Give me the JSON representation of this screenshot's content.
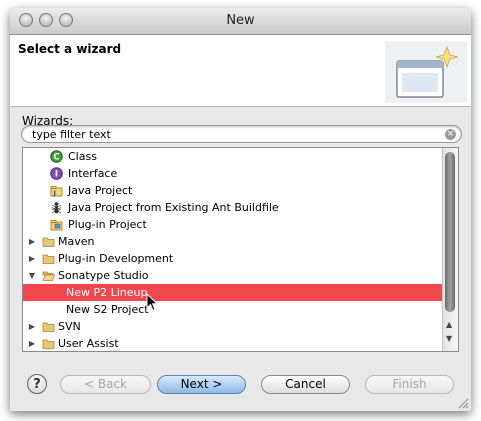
{
  "window": {
    "title": "New"
  },
  "header": {
    "title": "Select a wizard"
  },
  "wizards": {
    "label": "Wizards:",
    "filter_placeholder": "type filter text",
    "items": [
      {
        "label": "Class",
        "icon": "class-icon",
        "depth": 1,
        "disclosure": "none"
      },
      {
        "label": "Interface",
        "icon": "interface-icon",
        "depth": 1,
        "disclosure": "none"
      },
      {
        "label": "Java Project",
        "icon": "java-project-icon",
        "depth": 1,
        "disclosure": "none"
      },
      {
        "label": "Java Project from Existing Ant Buildfile",
        "icon": "ant-icon",
        "depth": 1,
        "disclosure": "none"
      },
      {
        "label": "Plug-in Project",
        "icon": "plugin-project-icon",
        "depth": 1,
        "disclosure": "none"
      },
      {
        "label": "Maven",
        "icon": "folder-icon",
        "depth": 0,
        "disclosure": "collapsed"
      },
      {
        "label": "Plug-in Development",
        "icon": "folder-icon",
        "depth": 0,
        "disclosure": "collapsed"
      },
      {
        "label": "Sonatype Studio",
        "icon": "folder-open-icon",
        "depth": 0,
        "disclosure": "expanded"
      },
      {
        "label": "New P2 Lineup",
        "icon": "",
        "depth": 2,
        "disclosure": "none",
        "selected": true
      },
      {
        "label": "New S2 Project",
        "icon": "",
        "depth": 2,
        "disclosure": "none"
      },
      {
        "label": "SVN",
        "icon": "folder-icon",
        "depth": 0,
        "disclosure": "collapsed"
      },
      {
        "label": "User Assist",
        "icon": "folder-icon",
        "depth": 0,
        "disclosure": "collapsed"
      }
    ]
  },
  "buttons": {
    "help": "?",
    "back": "< Back",
    "next": "Next >",
    "cancel": "Cancel",
    "finish": "Finish"
  },
  "colors": {
    "selection": "#ef474c",
    "default_button": "#8eb9ea"
  }
}
